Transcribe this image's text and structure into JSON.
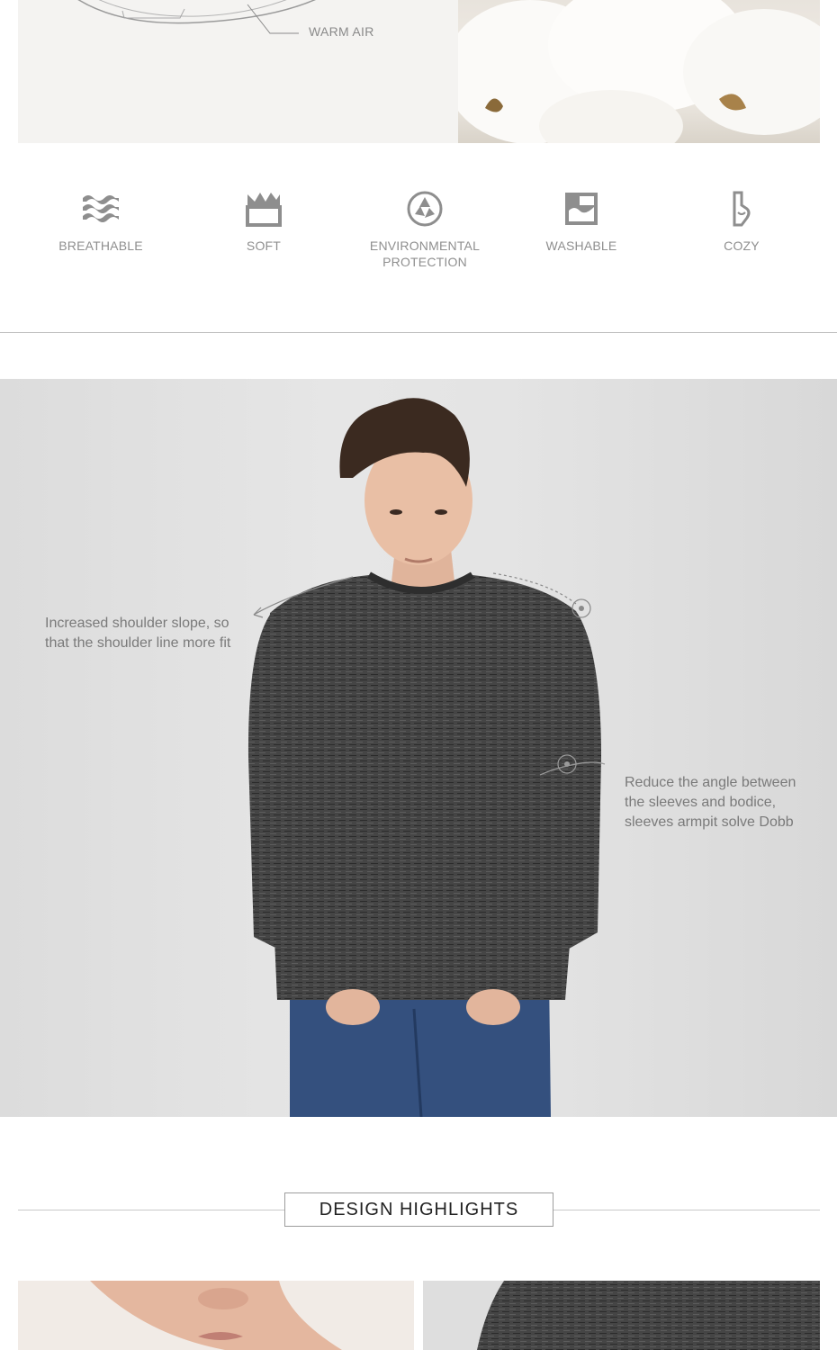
{
  "banner": {
    "warm_label": "WARM AIR"
  },
  "features": [
    {
      "icon": "waves-icon",
      "label": "BREATHABLE"
    },
    {
      "icon": "crown-box-icon",
      "label": "SOFT"
    },
    {
      "icon": "recycle-icon",
      "label": "ENVIRONMENTAL\nPROTECTION"
    },
    {
      "icon": "wash-icon",
      "label": "WASHABLE"
    },
    {
      "icon": "hand-icon",
      "label": "COZY"
    }
  ],
  "model": {
    "callout_left": "Increased shoulder slope, so that the shoulder line more fit",
    "callout_right": "Reduce the angle between the sleeves and bodice, sleeves armpit solve Dobb"
  },
  "highlights": {
    "title": "DESIGN HIGHLIGHTS"
  },
  "colors": {
    "icon_gray": "#8e8e8e",
    "text_gray": "#7a7a7a",
    "sweater": "#3d3d3d",
    "jeans": "#2e4a78"
  }
}
